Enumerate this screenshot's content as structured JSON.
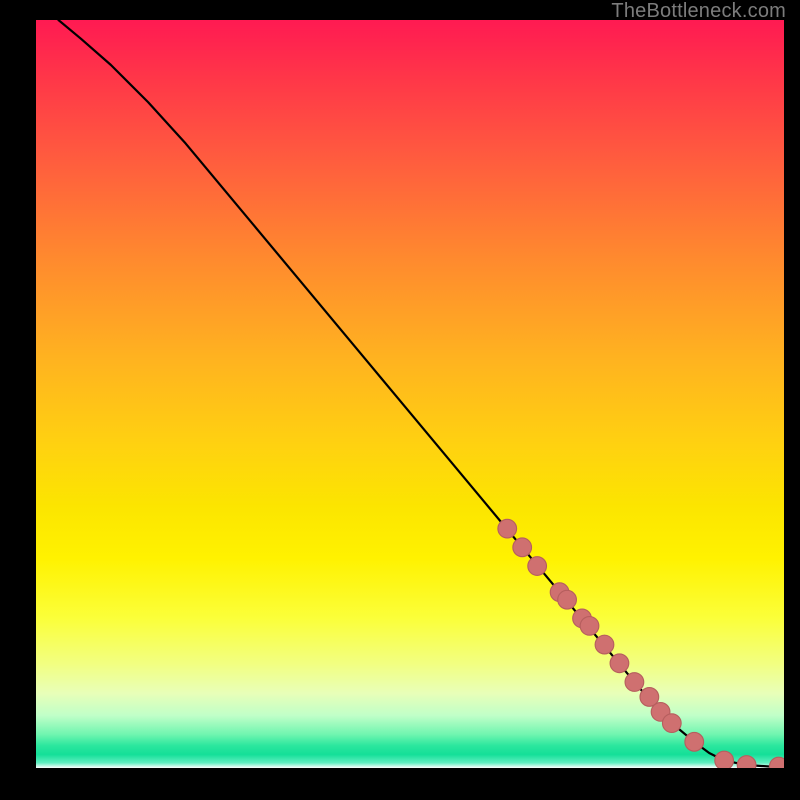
{
  "attribution_text": "TheBottleneck.com",
  "colors": {
    "page_bg": "#000000",
    "curve": "#000000",
    "marker_fill": "#cf7070",
    "marker_stroke": "#b65e5e",
    "attribution": "#7c7c7c"
  },
  "chart_data": {
    "type": "line",
    "title": "",
    "xlabel": "",
    "ylabel": "",
    "xlim": [
      0,
      100
    ],
    "ylim": [
      0,
      100
    ],
    "grid": false,
    "legend": false,
    "notes": "No axis ticks or labels are shown; all x/y values are estimated on a 0–100 scale proportional to the square plot area. The curve starts near the top-left, is slightly convex at first, then is nearly straight until it flattens out along the bottom edge at the right. Salmon-colored markers highlight the lower portion of the curve.",
    "series": [
      {
        "name": "curve",
        "x": [
          3,
          6,
          10,
          15,
          20,
          25,
          30,
          35,
          40,
          45,
          50,
          55,
          60,
          65,
          70,
          75,
          80,
          83,
          85,
          88,
          90,
          92,
          95,
          98,
          100
        ],
        "y": [
          100,
          97.5,
          94,
          89,
          83.5,
          77.5,
          71.5,
          65.5,
          59.5,
          53.5,
          47.5,
          41.5,
          35.5,
          29.5,
          23.5,
          17.5,
          11.5,
          8,
          6,
          3.5,
          2,
          1,
          0.4,
          0.2,
          0.2
        ]
      }
    ],
    "markers": [
      {
        "name": "highlight-points",
        "note": "Salmon markers along the lower segment and tail of the curve.",
        "x": [
          63,
          65,
          67,
          70,
          71,
          73,
          74,
          76,
          78,
          80,
          82,
          83.5,
          85,
          88,
          92,
          95,
          99.3
        ],
        "y": [
          32,
          29.5,
          27,
          23.5,
          22.5,
          20,
          19,
          16.5,
          14,
          11.5,
          9.5,
          7.5,
          6,
          3.5,
          1,
          0.4,
          0.2
        ]
      }
    ]
  }
}
